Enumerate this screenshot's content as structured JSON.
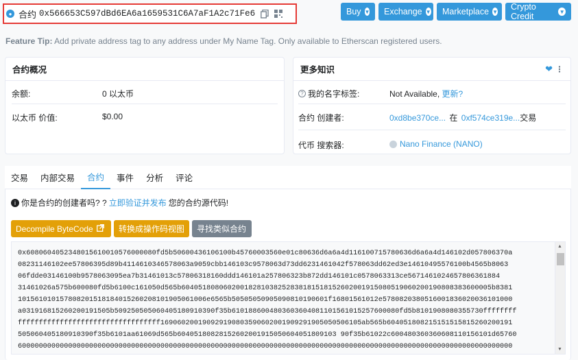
{
  "header": {
    "contract_label": "合约",
    "address": "0x566653C597dBd6EA6a1659531C6A7aF1A2c71Fe6",
    "nav_buttons": [
      "Buy",
      "Exchange",
      "Marketplace",
      "Crypto Credit"
    ]
  },
  "feature_tip": {
    "label": "Feature Tip:",
    "text": "Add private address tag to any address under My Name Tag. Only available to Etherscan registered users."
  },
  "overview": {
    "title": "合约概况",
    "balance_label": "余额:",
    "balance_value": "0 以太币",
    "value_label": "以太币 价值:",
    "value_value": "$0.00"
  },
  "more_info": {
    "title": "更多知识",
    "name_tag_label": "我的名字标签:",
    "name_tag_value": "Not Available,",
    "name_tag_link": "更新?",
    "creator_label": "合约 创建者:",
    "creator_addr": "0xd8be370ce...",
    "creator_at": "在",
    "creator_tx": "0xf574ce319e...",
    "creator_suffix": "交易",
    "tracker_label": "代币 搜索器:",
    "tracker_value": "Nano Finance (NANO)"
  },
  "tabs": [
    "交易",
    "内部交易",
    "合约",
    "事件",
    "分析",
    "评论"
  ],
  "active_tab": "合约",
  "verify": {
    "prefix": "你是合约的创建者吗? ?",
    "link": "立即验证并发布",
    "suffix": "您的合约源代码!"
  },
  "actions": {
    "decompile": "Decompile ByteCode",
    "opcode": "转换成操作码视图",
    "similar": "寻找类似合约"
  },
  "bytecode_lines": [
    "0x6080604052348015610010576000080fd5b50600436106100b45760003560e01c80636d6a6a4d116100715780636d6a6a4d146102d057806370a",
    "08231146102ee57806395d89b4114610346578063a9059cbb146103c9578063d73dd6231461042f578063dd62ed3e14610495576100b4565b8063",
    "06fdde03146100b9578063095ea7b31461013c57806318160ddd146101a257806323b872dd146101c0578063313ce5671461024657806361884",
    "31461026a575b600080fd5b6100c161050d565b60405180806020018281038252838181518152602001915080519060200190808383600005b8381",
    "101561010157808201518184015260208101905061006e6565b50505050905090810190601f16801561012e5780820380516001836020036101000",
    "a031916815260200191505b509250505060405180910390f35b6101886004803603604081101561015257600080fd5b8101908080355730ffffffff",
    "ffffffffffffffffffffffffffffffffff169060200190929190803590602001909291905050506105ab565b604051808215151515815260200191",
    "505060405180910390f35b6101aa61069d565b60405180828152602001915050604051809103 90f35b61022c600480360360608110156101d65760",
    "6000000000000000000000000000000000000000000000000000000000000000000000000000000000000000000000000000000000000000000000"
  ],
  "colors": {
    "accent": "#3498db",
    "decompile_bg": "#e3a008",
    "opcode_bg": "#e3a008",
    "similar_bg": "#77838f",
    "highlight_border": "#e53935"
  }
}
